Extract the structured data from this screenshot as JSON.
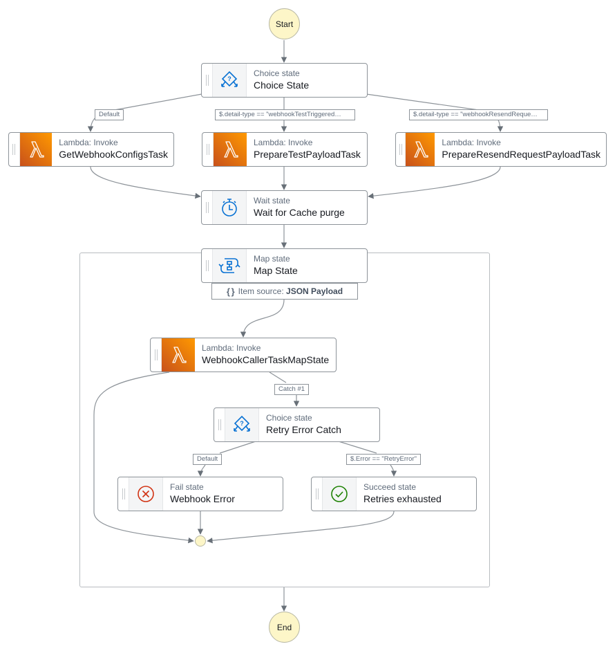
{
  "diagram": {
    "start_label": "Start",
    "end_label": "End",
    "nodes": {
      "choice_state": {
        "type_label": "Choice state",
        "name": "Choice State",
        "icon": "choice-icon"
      },
      "get_webhook_configs": {
        "type_label": "Lambda: Invoke",
        "name": "GetWebhookConfigsTask",
        "icon": "lambda-icon"
      },
      "prepare_test_payload": {
        "type_label": "Lambda: Invoke",
        "name": "PrepareTestPayloadTask",
        "icon": "lambda-icon"
      },
      "prepare_resend_payload": {
        "type_label": "Lambda: Invoke",
        "name": "PrepareResendRequestPayloadTask",
        "icon": "lambda-icon"
      },
      "wait_cache_purge": {
        "type_label": "Wait state",
        "name": "Wait for Cache purge",
        "icon": "timer-icon"
      },
      "map_state": {
        "type_label": "Map state",
        "name": "Map State",
        "icon": "map-icon"
      },
      "webhook_caller": {
        "type_label": "Lambda: Invoke",
        "name": "WebhookCallerTaskMapState",
        "icon": "lambda-icon"
      },
      "retry_error_catch": {
        "type_label": "Choice state",
        "name": "Retry Error Catch",
        "icon": "choice-icon"
      },
      "webhook_error": {
        "type_label": "Fail state",
        "name": "Webhook Error",
        "icon": "fail-icon"
      },
      "retries_exhausted": {
        "type_label": "Succeed state",
        "name": "Retries exhausted",
        "icon": "succeed-icon"
      }
    },
    "item_source": {
      "prefix": "Item source:",
      "value": "JSON Payload"
    },
    "edge_labels": {
      "choice_default": "Default",
      "choice_test": "$.detail-type == \"webhookTestTriggered…",
      "choice_resend": "$.detail-type == \"webhookResendReque…",
      "catch": "Catch #1",
      "retry_default": "Default",
      "retry_error": "$.Error == \"RetryError\""
    },
    "colors": {
      "terminal_fill": "#fdf6c8",
      "edge": "#687078",
      "lambda_start": "#c8511b",
      "lambda_end": "#ff9900",
      "choice_blue": "#0972d3",
      "fail_red": "#d13212",
      "succeed_green": "#1d8102"
    }
  }
}
